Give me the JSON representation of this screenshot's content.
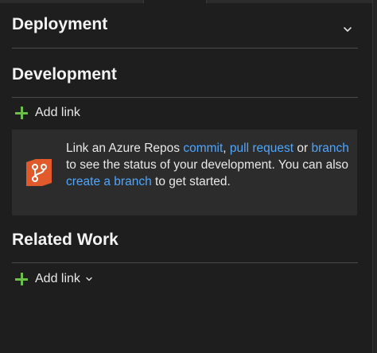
{
  "deployment": {
    "title": "Deployment"
  },
  "development": {
    "title": "Development",
    "add_link_label": "Add link",
    "info": {
      "text_1": "Link an Azure Repos ",
      "link_commit": "commit",
      "sep_1": ", ",
      "link_pull_request": "pull request",
      "text_2": " or ",
      "link_branch": "branch",
      "text_3": " to see the status of your development. You can also ",
      "link_create_branch": "create a branch",
      "text_4": " to get started."
    }
  },
  "related_work": {
    "title": "Related Work",
    "add_link_label": "Add link"
  },
  "colors": {
    "accent_link": "#4ea6ff",
    "plus_green": "#6cc04a",
    "repo_icon_bg": "#e05a2b"
  },
  "icons": {
    "deployment_chevron": "chevron-down-icon",
    "repo": "azure-repos-icon"
  }
}
